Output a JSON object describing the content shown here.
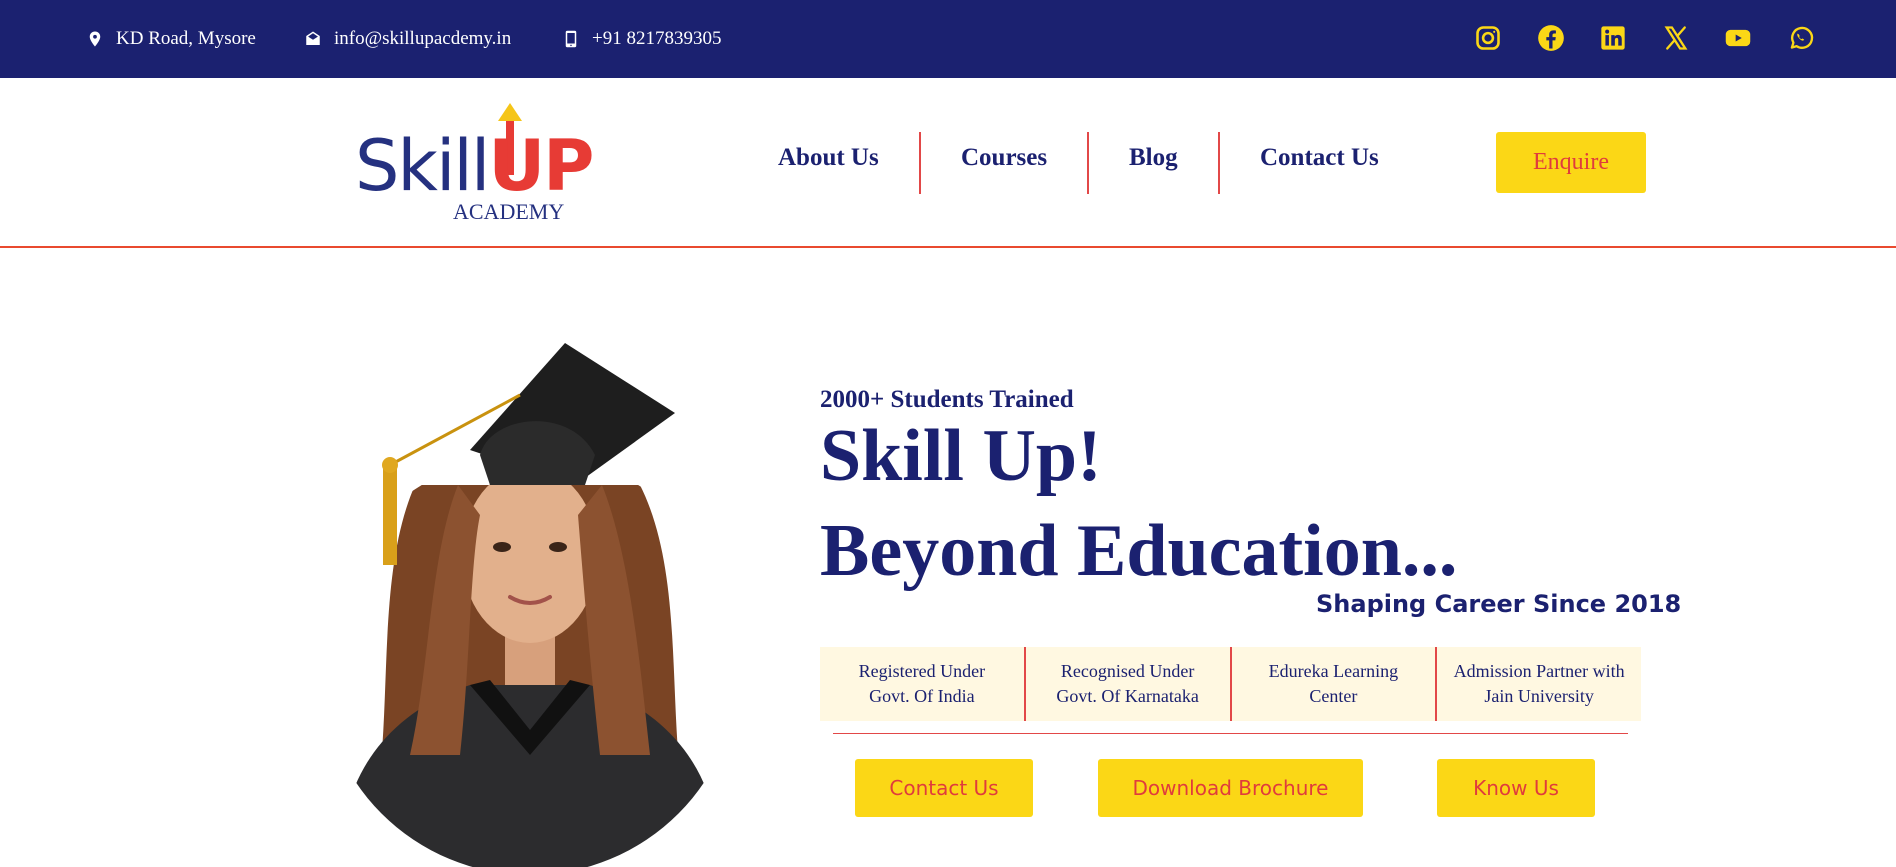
{
  "topbar": {
    "address": "KD Road, Mysore",
    "email": "info@skillupacdemy.in",
    "phone": "+91 8217839305",
    "social_icons": [
      "instagram-icon",
      "facebook-icon",
      "linkedin-icon",
      "x-icon",
      "youtube-icon",
      "whatsapp-icon"
    ]
  },
  "logo": {
    "skill": "Skill",
    "up": "UP",
    "sub": "ACADEMY"
  },
  "nav": {
    "items": [
      "About Us",
      "Courses",
      "Blog",
      "Contact Us"
    ],
    "enquire": "Enquire"
  },
  "hero": {
    "kicker": "2000+ Students Trained",
    "headline1": "Skill Up!",
    "headline2": "Beyond Education...",
    "tagline": "Shaping Career Since 2018",
    "badges": [
      {
        "line1": "Registered Under",
        "line2": "Govt. Of India"
      },
      {
        "line1": "Recognised Under",
        "line2": "Govt. Of Karnataka"
      },
      {
        "line1": "Edureka Learning",
        "line2": "Center"
      },
      {
        "line1": "Admission Partner with",
        "line2": "Jain University"
      }
    ],
    "buttons": [
      "Contact Us",
      "Download Brochure",
      "Know Us"
    ]
  },
  "colors": {
    "navy": "#1b2170",
    "accent_red": "#e24848",
    "yellow": "#fbd716",
    "badge_bg": "#fff8e1"
  }
}
